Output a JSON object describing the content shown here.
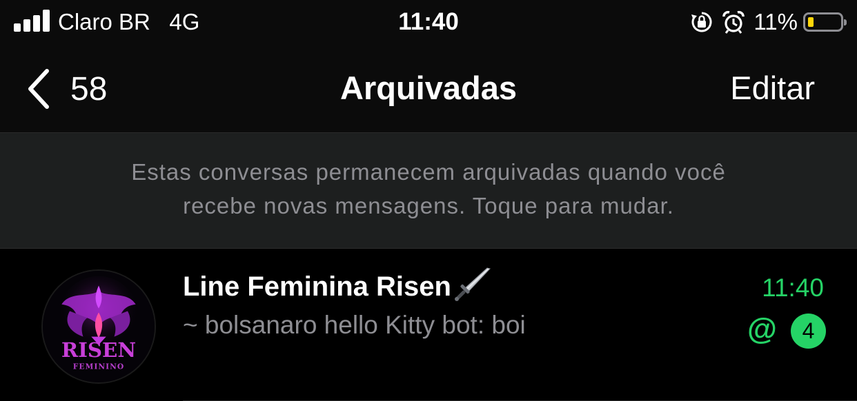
{
  "status_bar": {
    "carrier": "Claro BR",
    "network": "4G",
    "time": "11:40",
    "battery_percent": "11%",
    "battery_level": 0.11,
    "icons": [
      "signal-icon",
      "rotation-lock-icon",
      "alarm-icon",
      "battery-icon"
    ]
  },
  "nav": {
    "back_count": "58",
    "title": "Arquivadas",
    "edit_label": "Editar"
  },
  "info_banner": {
    "line1": "Estas conversas permanecem arquivadas quando você",
    "line2": "recebe novas mensagens. Toque para mudar."
  },
  "chats": [
    {
      "name": "Line Feminina Risen",
      "name_icon": "dagger-icon",
      "preview_prefix": "~",
      "preview_sender": "bolsanaro hello Kitty bot",
      "preview_message": ": boi",
      "time": "11:40",
      "mention": "@",
      "unread_count": "4",
      "avatar": {
        "text": "RISEN",
        "subtext": "FEMININO"
      }
    }
  ],
  "colors": {
    "accent_green": "#25d366",
    "secondary_text": "#8e8e93",
    "banner_bg": "#1d1f1f",
    "battery_low": "#ffd60a"
  }
}
